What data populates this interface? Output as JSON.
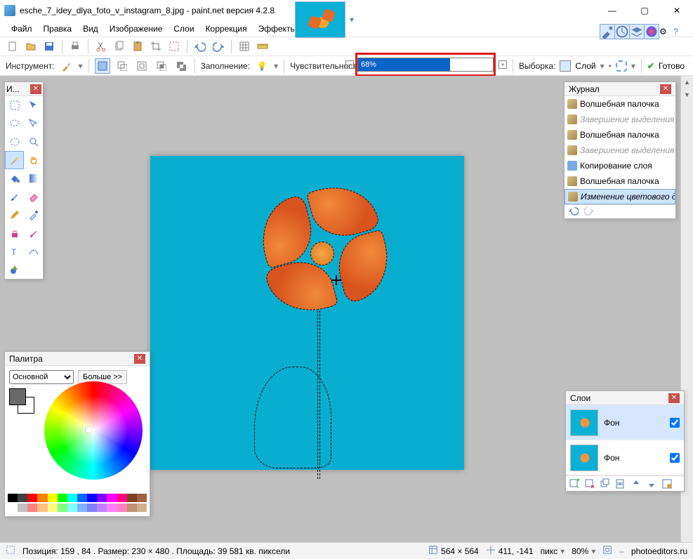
{
  "title": "esche_7_idey_dlya_foto_v_instagram_8.jpg - paint.net версия 4.2.8",
  "menu": {
    "file": "Файл",
    "edit": "Правка",
    "view": "Вид",
    "image": "Изображение",
    "layers": "Слои",
    "adjust": "Коррекция",
    "effects": "Эффекты"
  },
  "toolbar2": {
    "instrument": "Инструмент:",
    "fill": "Заполнение:",
    "tolerance": "Чувствительность:",
    "tol_value": "68%",
    "tol_percent": 68,
    "selection_label": "Выборка:",
    "selection_value": "Слой",
    "finish": "Готово"
  },
  "tools_title": "И...",
  "palette": {
    "title": "Палитра",
    "mode": "Основной",
    "more": "Больше >>"
  },
  "history": {
    "title": "Журнал",
    "items": [
      {
        "label": "Волшебная палочка",
        "kind": "wand"
      },
      {
        "label": "Завершение выделения палочкой",
        "kind": "dim"
      },
      {
        "label": "Волшебная палочка",
        "kind": "wand"
      },
      {
        "label": "Завершение выделения палочкой",
        "kind": "dim"
      },
      {
        "label": "Копирование слоя",
        "kind": "copy"
      },
      {
        "label": "Волшебная палочка",
        "kind": "wand"
      },
      {
        "label": "Изменение цветового диапазона",
        "kind": "sel"
      }
    ]
  },
  "layers": {
    "title": "Слои",
    "items": [
      {
        "name": "Фон",
        "checked": true,
        "selected": true
      },
      {
        "name": "Фон",
        "checked": true,
        "selected": false
      }
    ]
  },
  "status": {
    "pos": "Позиция: 159 , 84 . Размер: 230   × 480 . Площадь: 39 581 кв. пиксели",
    "canvas": "564  ×  564",
    "cursor": "411, -141",
    "unit": "пикс",
    "zoom": "80%",
    "site": "photoeditors.ru"
  },
  "swatch_row1": [
    "#000",
    "#404040",
    "#ff0000",
    "#ff7f00",
    "#ffff00",
    "#00ff00",
    "#00ffff",
    "#0066ff",
    "#0000ff",
    "#7f00ff",
    "#ff00ff",
    "#ff007f",
    "#804020",
    "#a06040"
  ],
  "swatch_row2": [
    "#fff",
    "#c0c0c0",
    "#ff8080",
    "#ffbf80",
    "#ffff80",
    "#80ff80",
    "#80ffff",
    "#80b3ff",
    "#8080ff",
    "#bf80ff",
    "#ff80ff",
    "#ff80bf",
    "#c09070",
    "#d0b090"
  ]
}
